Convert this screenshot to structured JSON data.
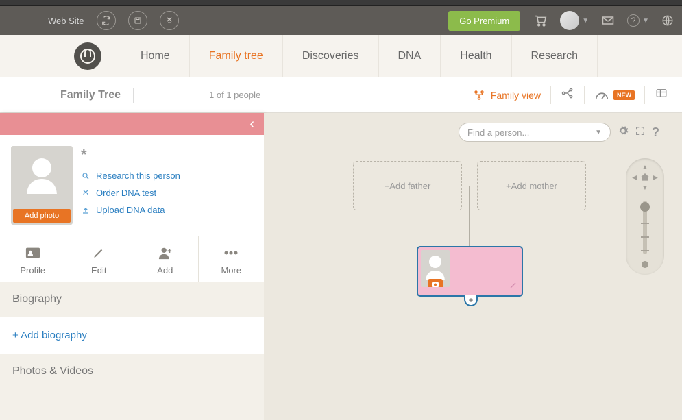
{
  "toolbar": {
    "website_label": "Web Site",
    "premium_label": "Go Premium"
  },
  "nav": {
    "items": [
      "Home",
      "Family tree",
      "Discoveries",
      "DNA",
      "Health",
      "Research"
    ],
    "active_index": 1
  },
  "subbar": {
    "title": "Family Tree",
    "people_count": "1 of 1 people",
    "family_view": "Family view",
    "new_badge": "NEW"
  },
  "panel": {
    "name": "*",
    "add_photo": "Add photo",
    "links": {
      "research": "Research this person",
      "order_dna": "Order DNA test",
      "upload_dna": "Upload DNA data"
    },
    "actions": {
      "profile": "Profile",
      "edit": "Edit",
      "add": "Add",
      "more": "More"
    },
    "biography_hdr": "Biography",
    "add_biography": "+ Add biography",
    "photos_hdr": "Photos & Videos"
  },
  "tree": {
    "find_placeholder": "Find a person...",
    "add_father": "+Add father",
    "add_mother": "+Add mother",
    "plus": "+",
    "help": "?"
  }
}
